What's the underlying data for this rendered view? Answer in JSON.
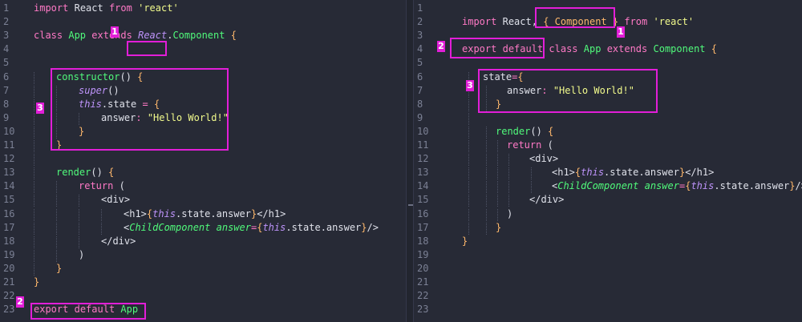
{
  "left": {
    "line_numbers": [
      "1",
      "2",
      "3",
      "4",
      "5",
      "6",
      "7",
      "8",
      "9",
      "10",
      "11",
      "12",
      "13",
      "14",
      "15",
      "16",
      "17",
      "18",
      "19",
      "20",
      "21",
      "22",
      "23"
    ],
    "l1": {
      "import": "import",
      "react": "React",
      "from": "from",
      "module": "'react'"
    },
    "l3": {
      "class": "class",
      "app": "App",
      "extends": "extends",
      "react": "React",
      "dot": ".",
      "component": "Component",
      "brace": "{"
    },
    "l6": {
      "ctor": "constructor",
      "paren": "()",
      "brace": "{"
    },
    "l7": {
      "super": "super",
      "paren": "()"
    },
    "l8": {
      "this": "this",
      "rest": ".state",
      "eq": " = ",
      "brace": "{"
    },
    "l9": {
      "key": "answer",
      "colon": ": ",
      "value": "\"Hello World!\""
    },
    "l10": {
      "brace": "}"
    },
    "l11": {
      "brace": "}"
    },
    "l13": {
      "render": "render",
      "paren": "()",
      "brace": "{"
    },
    "l14": {
      "ret": "return",
      "paren": "("
    },
    "l15": {
      "tag": "<div>"
    },
    "l16": {
      "open": "<h1>",
      "lb": "{",
      "this": "this",
      "expr": ".state.answer",
      "rb": "}",
      "close": "</h1>"
    },
    "l17": {
      "lt": "<",
      "comp": "ChildComponent",
      "attr": "answer",
      "eq": "=",
      "lb": "{",
      "this": "this",
      "expr": ".state.answer",
      "rb": "}",
      "end": "/>"
    },
    "l18": {
      "tag": "</div>"
    },
    "l19": {
      "paren": ")"
    },
    "l20": {
      "brace": "}"
    },
    "l21": {
      "brace": "}"
    },
    "l23": {
      "export": "export",
      "default": "default",
      "app": "App"
    },
    "badges": {
      "b1": "1",
      "b2": "2",
      "b3": "3"
    }
  },
  "right": {
    "line_numbers": [
      "1",
      "2",
      "3",
      "4",
      "5",
      "6",
      "7",
      "8",
      "9",
      "10",
      "11",
      "12",
      "13",
      "14",
      "15",
      "16",
      "17",
      "18",
      "19",
      "20",
      "21",
      "22",
      "23"
    ],
    "l2": {
      "import": "import",
      "react": "React,",
      "comp_import": "{ Component }",
      "from": "from",
      "module": "'react'"
    },
    "l4": {
      "export": "export",
      "default": "default",
      "class": "class",
      "app": "App",
      "extends": "extends",
      "component": "Component",
      "brace": "{"
    },
    "l6": {
      "state": "state",
      "eq": "=",
      "brace": "{"
    },
    "l7": {
      "key": "answer",
      "colon": ": ",
      "value": "\"Hello World!\""
    },
    "l8": {
      "brace": "}"
    },
    "l10": {
      "render": "render",
      "paren": "()",
      "brace": "{"
    },
    "l11": {
      "ret": "return",
      "paren": "("
    },
    "l12": {
      "tag": "<div>"
    },
    "l13": {
      "open": "<h1>",
      "lb": "{",
      "this": "this",
      "expr": ".state.answer",
      "rb": "}",
      "close": "</h1>"
    },
    "l14": {
      "lt": "<",
      "comp": "ChildComponent",
      "attr": "answer",
      "eq": "=",
      "lb": "{",
      "this": "this",
      "expr": ".state.answer",
      "rb": "}",
      "end": "/>"
    },
    "l15": {
      "tag": "</div>"
    },
    "l16": {
      "paren": ")"
    },
    "l17": {
      "brace": "}"
    },
    "l18": {
      "brace": "}"
    },
    "badges": {
      "b1": "1",
      "b2": "2",
      "b3": "3"
    }
  },
  "colors": {
    "highlight": "#e21ed8",
    "background": "#272a36",
    "keyword": "#ff79c6",
    "string": "#f1fa8c",
    "entity": "#50fa7b",
    "italic": "#bd93f9"
  }
}
